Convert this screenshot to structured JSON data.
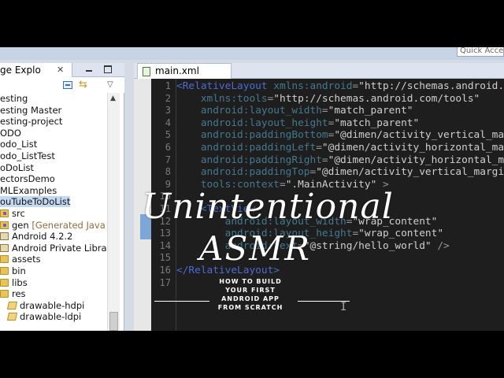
{
  "toolbar": {
    "quick_access": "Quick Access"
  },
  "explorer": {
    "tab_label": "ge Explo",
    "close_glyph": "✕",
    "items": [
      {
        "label": "esting",
        "indent": 0
      },
      {
        "label": "esting Master",
        "indent": 0
      },
      {
        "label": "esting-project",
        "indent": 0
      },
      {
        "label": "ODO",
        "indent": 0
      },
      {
        "label": "odo_List",
        "indent": 0
      },
      {
        "label": "odo_ListTest",
        "indent": 0
      },
      {
        "label": "oDoList",
        "indent": 0
      },
      {
        "label": "ectorsDemo",
        "indent": 0
      },
      {
        "label": "MLExamples",
        "indent": 0
      },
      {
        "label": "ouTubeToDoList",
        "indent": 0
      },
      {
        "label": "src",
        "indent": 1
      },
      {
        "label": "gen",
        "suffix": " [Generated Java F",
        "indent": 1
      },
      {
        "label": "Android 4.2.2",
        "indent": 1
      },
      {
        "label": "Android Private Libra",
        "indent": 1
      },
      {
        "label": "assets",
        "indent": 1
      },
      {
        "label": "bin",
        "indent": 1
      },
      {
        "label": "libs",
        "indent": 1
      },
      {
        "label": "res",
        "indent": 1
      },
      {
        "label": "drawable-hdpi",
        "indent": 2
      },
      {
        "label": "drawable-ldpi",
        "indent": 2
      }
    ]
  },
  "editor": {
    "tab_label": "main.xml",
    "lines": [
      {
        "n": "1",
        "parts": [
          [
            "tag",
            "<RelativeLayout "
          ],
          [
            "attr",
            "xmlns:android"
          ],
          [
            "eq",
            "="
          ],
          [
            "val",
            "\"http://schemas.android.com/apk/res/android\""
          ]
        ]
      },
      {
        "n": "2",
        "parts": [
          [
            "attr",
            "    xmlns:tools"
          ],
          [
            "eq",
            "="
          ],
          [
            "val",
            "\"http://schemas.android.com/tools\""
          ]
        ]
      },
      {
        "n": "3",
        "parts": [
          [
            "attr",
            "    android:layout_width"
          ],
          [
            "eq",
            "="
          ],
          [
            "val",
            "\"match_parent\""
          ]
        ]
      },
      {
        "n": "4",
        "parts": [
          [
            "attr",
            "    android:layout_height"
          ],
          [
            "eq",
            "="
          ],
          [
            "val",
            "\"match_parent\""
          ]
        ]
      },
      {
        "n": "5",
        "parts": [
          [
            "attr",
            "    android:paddingBottom"
          ],
          [
            "eq",
            "="
          ],
          [
            "val",
            "\"@dimen/activity_vertical_margin\""
          ]
        ]
      },
      {
        "n": "6",
        "parts": [
          [
            "attr",
            "    android:paddingLeft"
          ],
          [
            "eq",
            "="
          ],
          [
            "val",
            "\"@dimen/activity_horizontal_margin\""
          ]
        ]
      },
      {
        "n": "7",
        "parts": [
          [
            "attr",
            "    android:paddingRight"
          ],
          [
            "eq",
            "="
          ],
          [
            "val",
            "\"@dimen/activity_horizontal_margin\""
          ]
        ]
      },
      {
        "n": "8",
        "parts": [
          [
            "attr",
            "    android:paddingTop"
          ],
          [
            "eq",
            "="
          ],
          [
            "val",
            "\"@dimen/activity_vertical_margin\""
          ]
        ]
      },
      {
        "n": "9",
        "parts": [
          [
            "attr",
            "    tools:context"
          ],
          [
            "eq",
            "="
          ],
          [
            "val",
            "\".MainActivity\""
          ],
          [
            "plain",
            " >"
          ]
        ]
      },
      {
        "n": "10",
        "parts": []
      },
      {
        "n": "11",
        "parts": [
          [
            "tag",
            "    <TextView"
          ]
        ]
      },
      {
        "n": "12",
        "parts": [
          [
            "attr",
            "        android:layout_width"
          ],
          [
            "eq",
            "="
          ],
          [
            "val",
            "\"wrap_content\""
          ]
        ]
      },
      {
        "n": "13",
        "parts": [
          [
            "attr",
            "        android:layout_height"
          ],
          [
            "eq",
            "="
          ],
          [
            "val",
            "\"wrap_content\""
          ]
        ]
      },
      {
        "n": "14",
        "parts": [
          [
            "attr",
            "        android:text"
          ],
          [
            "eq",
            "="
          ],
          [
            "val",
            "\"@string/hello_world\""
          ],
          [
            "plain",
            " />"
          ]
        ]
      },
      {
        "n": "15",
        "parts": []
      },
      {
        "n": "16",
        "parts": [
          [
            "tag",
            "</RelativeLayout>"
          ]
        ]
      },
      {
        "n": "17",
        "parts": []
      }
    ]
  },
  "overlay": {
    "title": "Unintentional",
    "subtitle": "ASMR",
    "caption": "HOW TO BUILD YOUR FIRST ANDROID APP FROM SCRATCH"
  },
  "colors": {
    "code_bg": "#1e1e1e",
    "tag": "#4f6bd1",
    "attr": "#46788e",
    "value": "#cfcfcf"
  }
}
